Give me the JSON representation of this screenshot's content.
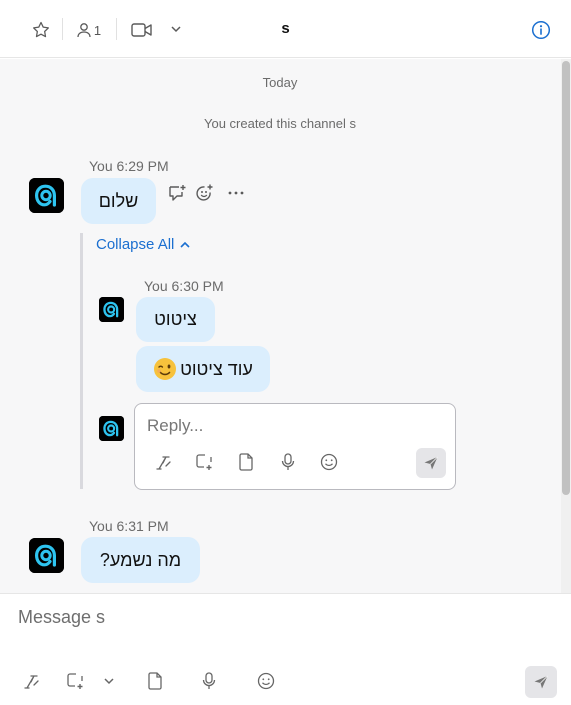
{
  "header": {
    "title": "s",
    "member_count": "1"
  },
  "feed": {
    "date_divider": "Today",
    "system_message": "You created this channel s",
    "messages": [
      {
        "sender": "You",
        "time": "6:29 PM",
        "text": "שלום"
      },
      {
        "sender": "You",
        "time": "6:31 PM",
        "text": "מה נשמע?"
      }
    ],
    "thread": {
      "collapse_label": "Collapse All",
      "replies": [
        {
          "sender": "You",
          "time": "6:30 PM",
          "text": "ציטוט"
        },
        {
          "sender": "You",
          "time": "",
          "text": "עוד ציטוט"
        }
      ],
      "reply_placeholder": "Reply..."
    }
  },
  "composer": {
    "placeholder": "Message s"
  },
  "colors": {
    "accent": "#1b6fd0",
    "bubble": "#dbeefd",
    "avatar_ring": "#2ec4f0"
  },
  "icons": [
    "star-icon",
    "members-icon",
    "video-icon",
    "chevron-down-icon",
    "info-icon",
    "reply-thread-icon",
    "add-reaction-icon",
    "more-icon",
    "chevron-up-icon",
    "format-icon",
    "screenshot-icon",
    "file-icon",
    "microphone-icon",
    "emoji-icon",
    "send-icon"
  ]
}
